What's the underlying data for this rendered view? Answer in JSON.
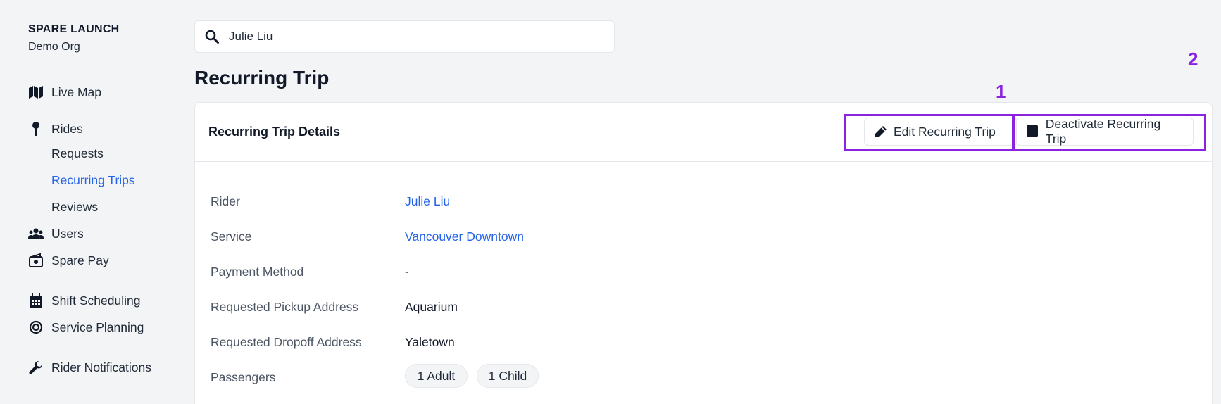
{
  "org": {
    "name": "SPARE LAUNCH",
    "subtitle": "Demo Org"
  },
  "sidebar": {
    "live_map": "Live Map",
    "rides": "Rides",
    "rides_sub": [
      "Requests",
      "Recurring Trips",
      "Reviews"
    ],
    "active_item": "Recurring Trips",
    "users": "Users",
    "spare_pay": "Spare Pay",
    "shift_scheduling": "Shift Scheduling",
    "service_planning": "Service Planning",
    "rider_notifications": "Rider Notifications"
  },
  "search": {
    "value": "Julie Liu"
  },
  "page": {
    "title": "Recurring Trip"
  },
  "card": {
    "title": "Recurring Trip Details",
    "edit_label": "Edit Recurring Trip",
    "deactivate_label": "Deactivate Recurring Trip"
  },
  "annotations": {
    "one": "1",
    "two": "2",
    "color": "#8b22e0"
  },
  "details": {
    "rider_label": "Rider",
    "rider_value": "Julie Liu",
    "service_label": "Service",
    "service_value": "Vancouver Downtown",
    "payment_label": "Payment Method",
    "payment_value": "-",
    "pickup_label": "Requested Pickup Address",
    "pickup_value": "Aquarium",
    "dropoff_label": "Requested Dropoff Address",
    "dropoff_value": "Yaletown",
    "passengers_label": "Passengers",
    "passengers": [
      "1 Adult",
      "1 Child"
    ]
  },
  "colors": {
    "accent": "#2563eb",
    "highlight": "#8b22e0"
  }
}
